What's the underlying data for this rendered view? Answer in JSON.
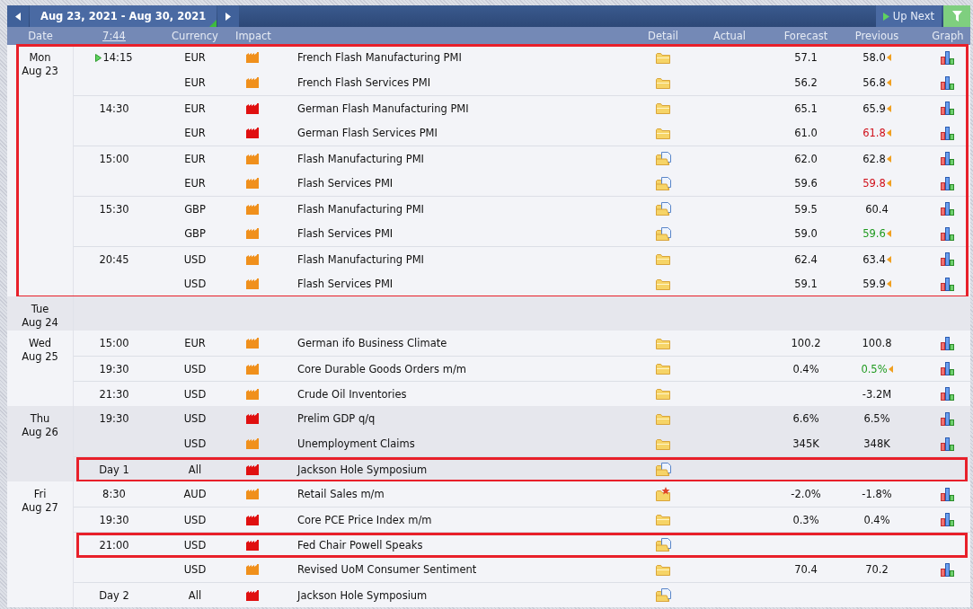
{
  "toolbar": {
    "range": "Aug 23, 2021 - Aug 30, 2021",
    "up_next": "Up Next"
  },
  "header": {
    "date": "Date",
    "time": "7:44",
    "currency": "Currency",
    "impact": "Impact",
    "detail": "Detail",
    "actual": "Actual",
    "forecast": "Forecast",
    "previous": "Previous",
    "graph": "Graph"
  },
  "days": [
    {
      "weekday": "Mon",
      "date": "Aug 23",
      "shaded": false,
      "highlighted": true,
      "events": [
        {
          "time": "14:15",
          "next": true,
          "currency": "EUR",
          "high_impact": false,
          "title": "French Flash Manufacturing PMI",
          "detail": {
            "kind": "folder"
          },
          "forecast": "57.1",
          "previous": {
            "value": "58.0",
            "color": "#111111"
          },
          "revised": true,
          "graph": true,
          "highlighted": false
        },
        {
          "next": false,
          "currency": "EUR",
          "high_impact": false,
          "title": "French Flash Services PMI",
          "detail": {
            "kind": "folder"
          },
          "forecast": "56.2",
          "previous": {
            "value": "56.8",
            "color": "#111111"
          },
          "revised": true,
          "graph": true,
          "highlighted": false
        },
        {
          "time": "14:30",
          "next": false,
          "currency": "EUR",
          "high_impact": true,
          "title": "German Flash Manufacturing PMI",
          "detail": {
            "kind": "folder"
          },
          "forecast": "65.1",
          "previous": {
            "value": "65.9",
            "color": "#111111"
          },
          "revised": true,
          "graph": true,
          "highlighted": false
        },
        {
          "next": false,
          "currency": "EUR",
          "high_impact": true,
          "title": "German Flash Services PMI",
          "detail": {
            "kind": "folder"
          },
          "forecast": "61.0",
          "previous": {
            "value": "61.8",
            "color": "#d0101a"
          },
          "revised": true,
          "graph": true,
          "highlighted": false
        },
        {
          "time": "15:00",
          "next": false,
          "currency": "EUR",
          "high_impact": false,
          "title": "Flash Manufacturing PMI",
          "detail": {
            "kind": "folder-doc"
          },
          "forecast": "62.0",
          "previous": {
            "value": "62.8",
            "color": "#111111"
          },
          "revised": true,
          "graph": true,
          "highlighted": false
        },
        {
          "next": false,
          "currency": "EUR",
          "high_impact": false,
          "title": "Flash Services PMI",
          "detail": {
            "kind": "folder-doc"
          },
          "forecast": "59.6",
          "previous": {
            "value": "59.8",
            "color": "#d0101a"
          },
          "revised": true,
          "graph": true,
          "highlighted": false
        },
        {
          "time": "15:30",
          "next": false,
          "currency": "GBP",
          "high_impact": false,
          "title": "Flash Manufacturing PMI",
          "detail": {
            "kind": "folder-doc"
          },
          "forecast": "59.5",
          "previous": {
            "value": "60.4",
            "color": "#111111"
          },
          "revised": false,
          "graph": true,
          "highlighted": false
        },
        {
          "next": false,
          "currency": "GBP",
          "high_impact": false,
          "title": "Flash Services PMI",
          "detail": {
            "kind": "folder-doc"
          },
          "forecast": "59.0",
          "previous": {
            "value": "59.6",
            "color": "#1f9a1f"
          },
          "revised": true,
          "graph": true,
          "highlighted": false
        },
        {
          "time": "20:45",
          "next": false,
          "currency": "USD",
          "high_impact": false,
          "title": "Flash Manufacturing PMI",
          "detail": {
            "kind": "folder"
          },
          "forecast": "62.4",
          "previous": {
            "value": "63.4",
            "color": "#111111"
          },
          "revised": true,
          "graph": true,
          "highlighted": false
        },
        {
          "next": false,
          "currency": "USD",
          "high_impact": false,
          "title": "Flash Services PMI",
          "detail": {
            "kind": "folder"
          },
          "forecast": "59.1",
          "previous": {
            "value": "59.9",
            "color": "#111111"
          },
          "revised": true,
          "graph": true,
          "highlighted": false
        }
      ]
    },
    {
      "weekday": "Tue",
      "date": "Aug 24",
      "shaded": true,
      "highlighted": false
    },
    {
      "weekday": "Wed",
      "date": "Aug 25",
      "shaded": false,
      "highlighted": false,
      "events": [
        {
          "time": "15:00",
          "next": false,
          "currency": "EUR",
          "high_impact": false,
          "title": "German ifo Business Climate",
          "detail": {
            "kind": "folder"
          },
          "forecast": "100.2",
          "previous": {
            "value": "100.8",
            "color": "#111111"
          },
          "revised": false,
          "graph": true,
          "highlighted": false
        },
        {
          "time": "19:30",
          "next": false,
          "currency": "USD",
          "high_impact": false,
          "title": "Core Durable Goods Orders m/m",
          "detail": {
            "kind": "folder"
          },
          "forecast": "0.4%",
          "previous": {
            "value": "0.5%",
            "color": "#1f9a1f"
          },
          "revised": true,
          "graph": true,
          "highlighted": false
        },
        {
          "time": "21:30",
          "next": false,
          "currency": "USD",
          "high_impact": false,
          "title": "Crude Oil Inventories",
          "detail": {
            "kind": "folder"
          },
          "previous": {
            "value": "-3.2M",
            "color": "#111111"
          },
          "revised": false,
          "graph": true,
          "highlighted": false
        }
      ]
    },
    {
      "weekday": "Thu",
      "date": "Aug 26",
      "shaded": true,
      "highlighted": false,
      "events": [
        {
          "time": "19:30",
          "next": false,
          "currency": "USD",
          "high_impact": true,
          "title": "Prelim GDP q/q",
          "detail": {
            "kind": "folder"
          },
          "forecast": "6.6%",
          "previous": {
            "value": "6.5%",
            "color": "#111111"
          },
          "revised": false,
          "graph": true,
          "highlighted": false
        },
        {
          "next": false,
          "currency": "USD",
          "high_impact": false,
          "title": "Unemployment Claims",
          "detail": {
            "kind": "folder"
          },
          "forecast": "345K",
          "previous": {
            "value": "348K",
            "color": "#111111"
          },
          "revised": false,
          "graph": true,
          "highlighted": false
        },
        {
          "time": "Day 1",
          "next": false,
          "currency": "All",
          "high_impact": true,
          "title": "Jackson Hole Symposium",
          "detail": {
            "kind": "folder-doc"
          },
          "revised": false,
          "graph": false,
          "highlighted": true
        }
      ]
    },
    {
      "weekday": "Fri",
      "date": "Aug 27",
      "shaded": false,
      "highlighted": false,
      "events": [
        {
          "time": "8:30",
          "next": false,
          "currency": "AUD",
          "high_impact": false,
          "title": "Retail Sales m/m",
          "detail": {
            "kind": "folder-star"
          },
          "forecast": "-2.0%",
          "previous": {
            "value": "-1.8%",
            "color": "#111111"
          },
          "revised": false,
          "graph": true,
          "highlighted": false
        },
        {
          "time": "19:30",
          "next": false,
          "currency": "USD",
          "high_impact": true,
          "title": "Core PCE Price Index m/m",
          "detail": {
            "kind": "folder"
          },
          "forecast": "0.3%",
          "previous": {
            "value": "0.4%",
            "color": "#111111"
          },
          "revised": false,
          "graph": true,
          "highlighted": false
        },
        {
          "time": "21:00",
          "next": false,
          "currency": "USD",
          "high_impact": true,
          "title": "Fed Chair Powell Speaks",
          "detail": {
            "kind": "folder-doc"
          },
          "revised": false,
          "graph": false,
          "highlighted": true
        },
        {
          "next": false,
          "currency": "USD",
          "high_impact": false,
          "title": "Revised UoM Consumer Sentiment",
          "detail": {
            "kind": "folder"
          },
          "forecast": "70.4",
          "previous": {
            "value": "70.2",
            "color": "#111111"
          },
          "revised": false,
          "graph": true,
          "highlighted": false
        },
        {
          "time": "Day 2",
          "next": false,
          "currency": "All",
          "high_impact": true,
          "title": "Jackson Hole Symposium",
          "detail": {
            "kind": "folder-doc"
          },
          "revised": false,
          "graph": false,
          "highlighted": false
        }
      ]
    }
  ]
}
